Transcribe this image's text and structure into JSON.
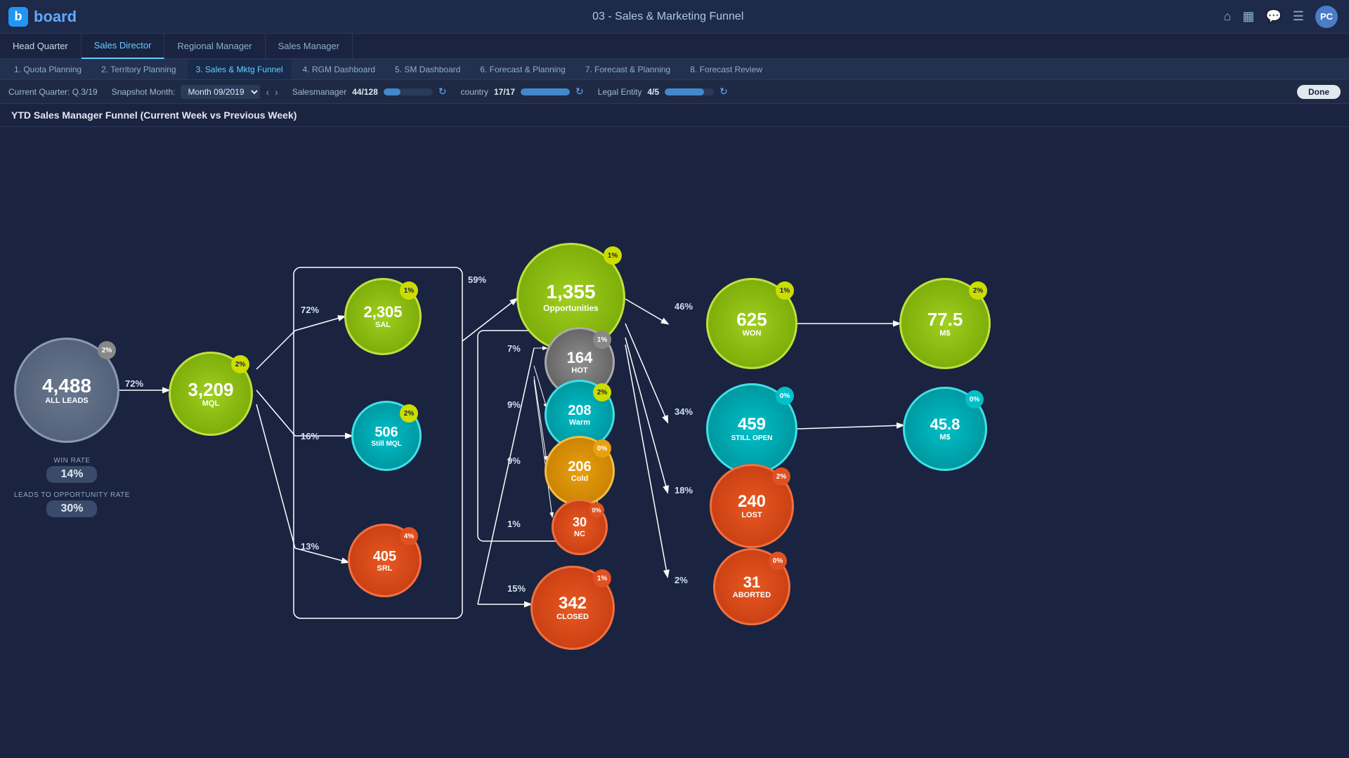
{
  "app": {
    "logo_letter": "b",
    "logo_name": "board",
    "page_title": "03 - Sales & Marketing Funnel",
    "user_initials": "PC"
  },
  "nav": {
    "tabs": [
      {
        "id": "hq",
        "label": "Head Quarter",
        "active": false
      },
      {
        "id": "sd",
        "label": "Sales Director",
        "active": true
      },
      {
        "id": "rm",
        "label": "Regional Manager",
        "active": false
      },
      {
        "id": "sm",
        "label": "Sales Manager",
        "active": false
      }
    ],
    "sub_tabs": [
      {
        "id": "1",
        "label": "1. Quota Planning",
        "active": false
      },
      {
        "id": "2",
        "label": "2. Territory Planning",
        "active": false
      },
      {
        "id": "3",
        "label": "3. Sales & Mktg Funnel",
        "active": true
      },
      {
        "id": "4",
        "label": "4. RGM Dashboard",
        "active": false
      },
      {
        "id": "5",
        "label": "5. SM Dashboard",
        "active": false
      },
      {
        "id": "6",
        "label": "6. Forecast & Planning",
        "active": false
      },
      {
        "id": "7",
        "label": "7. Forecast & Planning",
        "active": false
      },
      {
        "id": "8",
        "label": "8. Forecast Review",
        "active": false
      }
    ]
  },
  "filters": {
    "current_quarter_label": "Current Quarter: Q.3/19",
    "snapshot_month_label": "Snapshot Month:",
    "snapshot_month_value": "Month 09/2019",
    "salesmanager_label": "Salesmanager",
    "salesmanager_value": "44/128",
    "salesmanager_progress": 34,
    "country_label": "country",
    "country_value": "17/17",
    "country_progress": 100,
    "legal_entity_label": "Legal Entity",
    "legal_entity_value": "4/5",
    "legal_entity_progress": 80,
    "done_label": "Done"
  },
  "chart": {
    "title": "YTD Sales Manager Funnel (Current Week vs Previous Week)",
    "nodes": {
      "all_leads": {
        "value": "4,488",
        "label": "ALL LEADS",
        "badge": "2%"
      },
      "mql": {
        "value": "3,209",
        "label": "MQL",
        "badge": "2%"
      },
      "sal": {
        "value": "2,305",
        "label": "SAL",
        "badge": "1%"
      },
      "still_mql": {
        "value": "506",
        "label": "Still MQL",
        "badge": "2%"
      },
      "srl": {
        "value": "405",
        "label": "SRL",
        "badge": "4%"
      },
      "opportunities": {
        "value": "1,355",
        "label": "Opportunities",
        "badge": "1%"
      },
      "hot": {
        "value": "164",
        "label": "HOT",
        "badge": "1%"
      },
      "warm": {
        "value": "208",
        "label": "Warm",
        "badge": "2%"
      },
      "cold": {
        "value": "206",
        "label": "Cold",
        "badge": "0%"
      },
      "nc": {
        "value": "30",
        "label": "NC",
        "badge": "0%"
      },
      "closed": {
        "value": "342",
        "label": "CLOSED",
        "badge": "1%"
      },
      "won": {
        "value": "625",
        "label": "WON",
        "badge": "1%"
      },
      "still_open": {
        "value": "459",
        "label": "STILL OPEN",
        "badge": "0%"
      },
      "lost": {
        "value": "240",
        "label": "LOST",
        "badge": "2%"
      },
      "aborted": {
        "value": "31",
        "label": "ABORTED",
        "badge": "0%"
      },
      "won_ms": {
        "value": "77.5",
        "label": "M$",
        "badge": "2%"
      },
      "open_ms": {
        "value": "45.8",
        "label": "M$",
        "badge": "0%"
      }
    },
    "percentages": {
      "all_to_mql": "72%",
      "mql_to_sal": "72%",
      "mql_to_still": "16%",
      "mql_to_srl": "13%",
      "sal_to_opp": "59%",
      "opp_to_hot": "7%",
      "opp_to_warm": "9%",
      "opp_to_cold": "9%",
      "opp_to_nc": "1%",
      "opp_to_closed": "15%",
      "opp_to_won": "46%",
      "opp_to_stillopen": "34%",
      "opp_to_lost": "18%",
      "opp_to_aborted": "2%"
    },
    "win_rate_label": "WIN RATE",
    "win_rate_value": "14%",
    "leads_to_opp_label": "LEADS TO OPPORTUNITY RATE",
    "leads_to_opp_value": "30%"
  }
}
